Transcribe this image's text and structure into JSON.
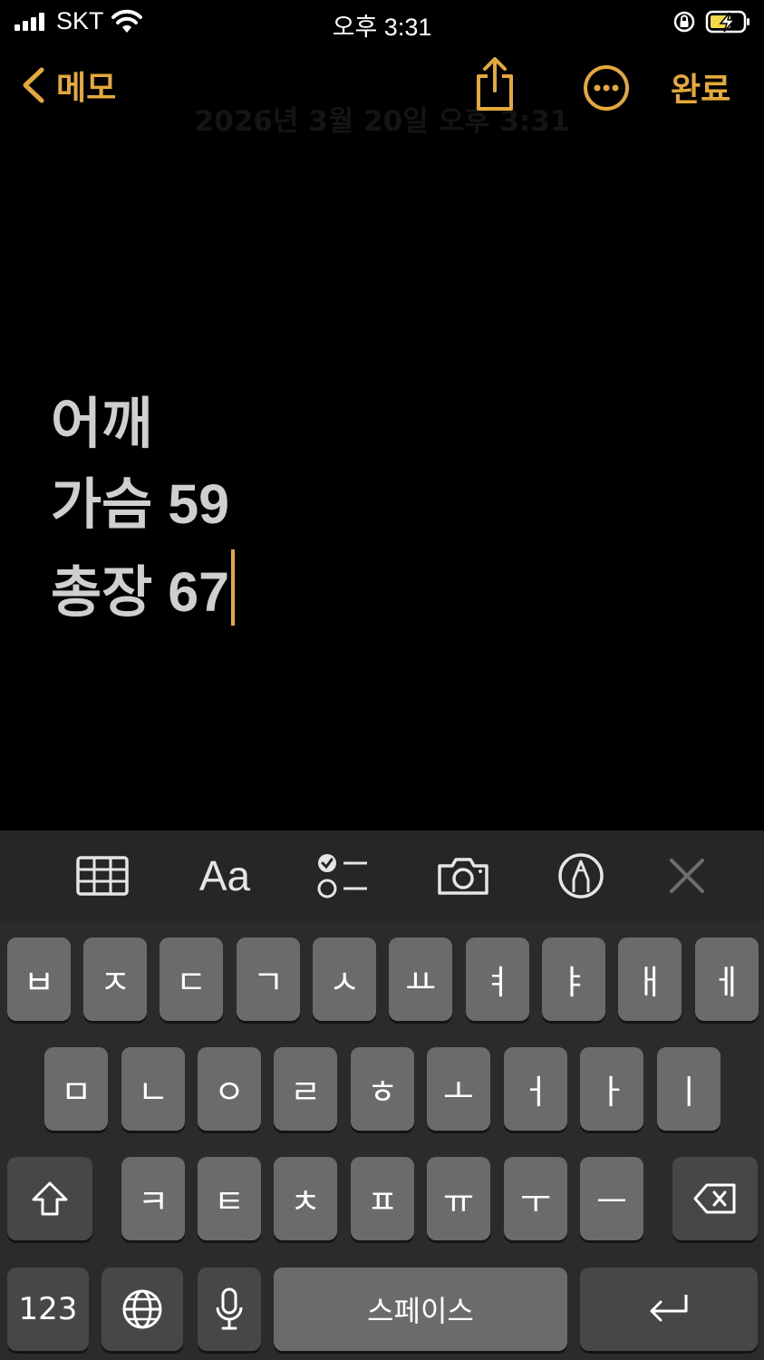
{
  "status_bar": {
    "carrier": "SKT",
    "time": "오후 3:31"
  },
  "nav": {
    "back_label": "메모",
    "done_label": "완료",
    "date_header": "2026년 3월 20일 오후 3:31"
  },
  "note": {
    "lines": [
      "어깨",
      "가슴 59",
      "총장 67"
    ]
  },
  "toolbar": {
    "format_label": "Aa",
    "icons": [
      "table-icon",
      "format-icon",
      "checklist-icon",
      "camera-icon",
      "markup-icon",
      "close-icon"
    ]
  },
  "keyboard": {
    "row1": [
      "ㅂ",
      "ㅈ",
      "ㄷ",
      "ㄱ",
      "ㅅ",
      "ㅛ",
      "ㅕ",
      "ㅑ",
      "ㅐ",
      "ㅔ"
    ],
    "row2": [
      "ㅁ",
      "ㄴ",
      "ㅇ",
      "ㄹ",
      "ㅎ",
      "ㅗ",
      "ㅓ",
      "ㅏ",
      "ㅣ"
    ],
    "row3": [
      "ㅋ",
      "ㅌ",
      "ㅊ",
      "ㅍ",
      "ㅠ",
      "ㅜ",
      "ㅡ"
    ],
    "numbers_label": "123",
    "space_label": "스페이스"
  },
  "colors": {
    "accent": "#e5a83a",
    "background": "#000000",
    "key": "#6b6b6b",
    "key_dark": "#474747",
    "toolbar": "#262626"
  }
}
